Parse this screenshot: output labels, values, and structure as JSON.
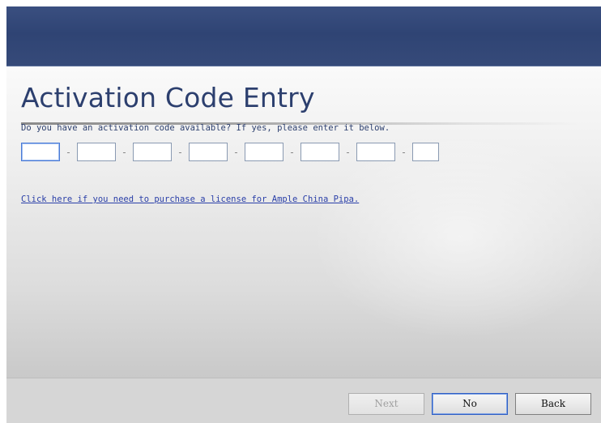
{
  "wizard": {
    "title": "Activation Code Entry",
    "prompt": "Do you have an activation code available? If yes, please enter it below.",
    "code_fields": [
      {
        "value": ""
      },
      {
        "value": ""
      },
      {
        "value": ""
      },
      {
        "value": ""
      },
      {
        "value": ""
      },
      {
        "value": ""
      },
      {
        "value": ""
      },
      {
        "value": ""
      }
    ],
    "separator": "-",
    "purchase_link": "Click here if you need to purchase a license for Ample China Pipa."
  },
  "footer": {
    "next_label": "Next",
    "no_label": "No",
    "back_label": "Back",
    "next_enabled": false
  },
  "colors": {
    "header": "#2f4474",
    "title": "#2c3f6e",
    "link": "#2a3fa8"
  }
}
